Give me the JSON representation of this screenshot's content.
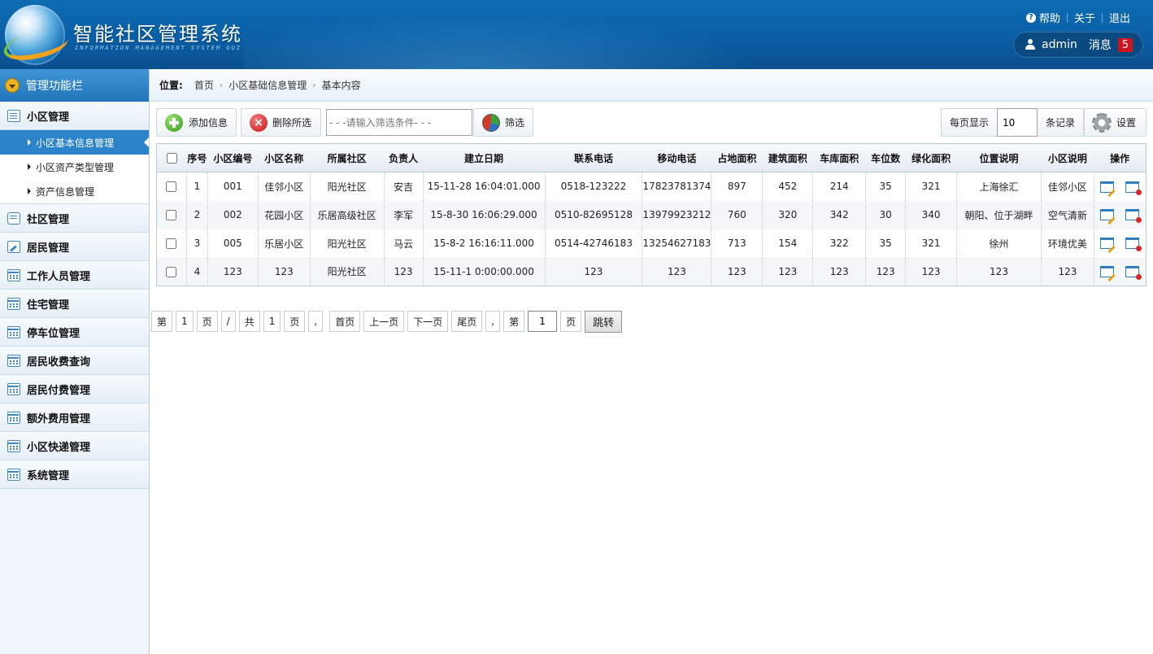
{
  "header": {
    "title": "智能社区管理系统",
    "subtitle": "INFORMATION MANAGEMENT SYSTEM GUI",
    "links": {
      "help": "帮助",
      "about": "关于",
      "logout": "退出"
    },
    "user": {
      "name": "admin",
      "message_label": "消息",
      "message_count": "5"
    }
  },
  "sidebar": {
    "title": "管理功能栏",
    "groups": [
      {
        "label": "小区管理",
        "icon": "list-icon",
        "children": [
          {
            "label": "小区基本信息管理",
            "active": true
          },
          {
            "label": "小区资产类型管理"
          },
          {
            "label": "资产信息管理"
          }
        ]
      },
      {
        "label": "社区管理",
        "icon": "chat-icon"
      },
      {
        "label": "居民管理",
        "icon": "edit-icon"
      },
      {
        "label": "工作人员管理",
        "icon": "calendar-icon"
      },
      {
        "label": "住宅管理",
        "icon": "calendar-icon"
      },
      {
        "label": "停车位管理",
        "icon": "calendar-icon"
      },
      {
        "label": "居民收费查询",
        "icon": "calendar-icon"
      },
      {
        "label": "居民付费管理",
        "icon": "calendar-icon"
      },
      {
        "label": "额外费用管理",
        "icon": "calendar-icon"
      },
      {
        "label": "小区快递管理",
        "icon": "calendar-icon"
      },
      {
        "label": "系统管理",
        "icon": "calendar-icon"
      }
    ]
  },
  "breadcrumb": {
    "label": "位置:",
    "items": [
      "首页",
      "小区基础信息管理",
      "基本内容"
    ]
  },
  "toolbar": {
    "add_label": "添加信息",
    "delete_label": "删除所选",
    "filter_placeholder": "- - -请输入筛选条件- - -",
    "filter_label": "筛选",
    "perpage_label": "每页显示",
    "perpage_value": "10",
    "perpage_unit": "条记录",
    "settings_label": "设置"
  },
  "table": {
    "columns": [
      "序号",
      "小区编号",
      "小区名称",
      "所属社区",
      "负责人",
      "建立日期",
      "联系电话",
      "移动电话",
      "占地面积",
      "建筑面积",
      "车库面积",
      "车位数",
      "绿化面积",
      "位置说明",
      "小区说明",
      "操作"
    ],
    "rows": [
      [
        "1",
        "001",
        "佳邻小区",
        "阳光社区",
        "安吉",
        "15-11-28 16:04:01.000",
        "0518-123222",
        "17823781374",
        "897",
        "452",
        "214",
        "35",
        "321",
        "上海徐汇",
        "佳邻小区"
      ],
      [
        "2",
        "002",
        "花园小区",
        "乐居高级社区",
        "李军",
        "15-8-30 16:06:29.000",
        "0510-82695128",
        "13979923212",
        "760",
        "320",
        "342",
        "30",
        "340",
        "朝阳、位于湖畔",
        "空气清新"
      ],
      [
        "3",
        "005",
        "乐居小区",
        "阳光社区",
        "马云",
        "15-8-2 16:16:11.000",
        "0514-42746183",
        "13254627183",
        "713",
        "154",
        "322",
        "35",
        "321",
        "徐州",
        "环境优美"
      ],
      [
        "4",
        "123",
        "123",
        "阳光社区",
        "123",
        "15-11-1 0:00:00.000",
        "123",
        "123",
        "123",
        "123",
        "123",
        "123",
        "123",
        "123",
        "123"
      ]
    ]
  },
  "pager": {
    "di": "第",
    "current": "1",
    "ye": "页",
    "slash": "/",
    "gong": "共",
    "total": "1",
    "comma": ",",
    "first": "首页",
    "prev": "上一页",
    "next": "下一页",
    "last": "尾页",
    "jump_value": "1",
    "go": "跳转"
  }
}
